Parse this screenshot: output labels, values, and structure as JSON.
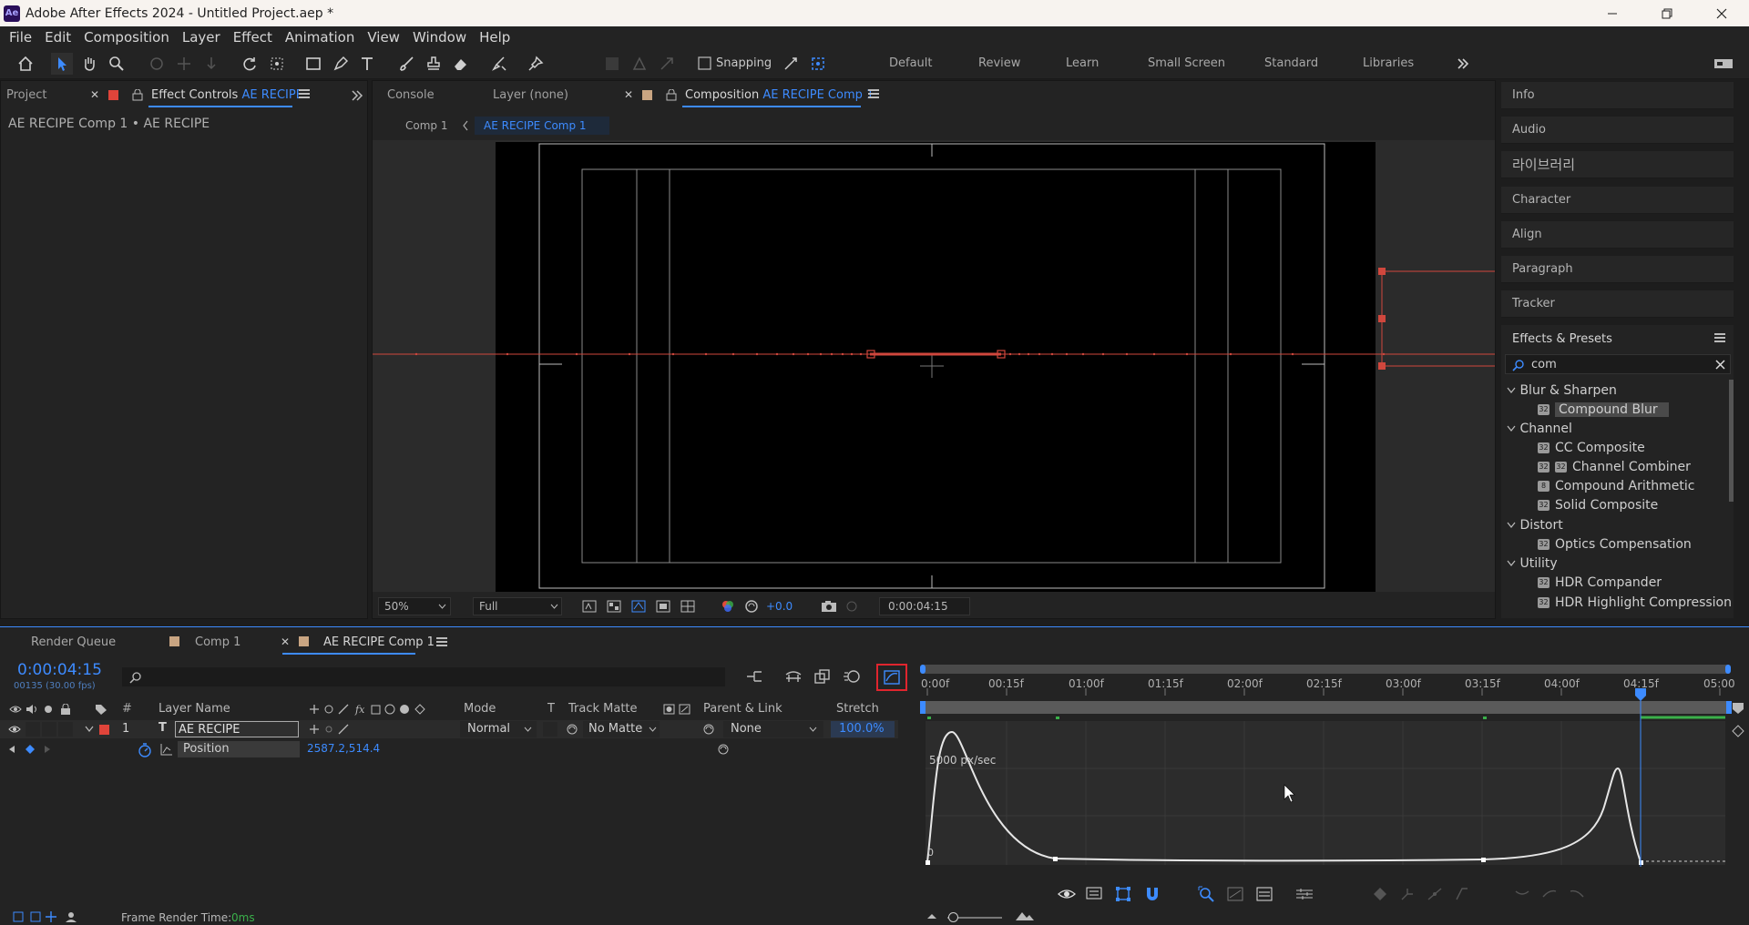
{
  "window": {
    "title": "Adobe After Effects 2024 - Untitled Project.aep *",
    "app_icon_text": "Ae"
  },
  "menu": [
    "File",
    "Edit",
    "Composition",
    "Layer",
    "Effect",
    "Animation",
    "View",
    "Window",
    "Help"
  ],
  "toolbar": {
    "snapping_label": "Snapping",
    "workspaces": [
      "Default",
      "Review",
      "Learn",
      "Small Screen",
      "Standard",
      "Libraries"
    ]
  },
  "left_panel": {
    "tab_project": "Project",
    "tab_effect_controls": "Effect Controls",
    "tab_effect_controls_layer": "AE RECIPE",
    "breadcrumb": "AE RECIPE Comp 1 • AE RECIPE"
  },
  "viewer": {
    "tab_console": "Console",
    "tab_layer": "Layer (none)",
    "tab_composition": "Composition",
    "tab_composition_name": "AE RECIPE Comp 1",
    "crumb_parent": "Comp 1",
    "crumb_current": "AE RECIPE Comp 1",
    "zoom": "50%",
    "resolution": "Full",
    "exposure": "+0.0",
    "timecode": "0:00:04:15"
  },
  "right_panels": [
    "Info",
    "Audio",
    "라이브러리",
    "Character",
    "Align",
    "Paragraph",
    "Tracker"
  ],
  "effects_presets": {
    "title": "Effects & Presets",
    "search_value": "com",
    "groups": [
      {
        "name": "Blur & Sharpen",
        "items": [
          "Compound Blur"
        ]
      },
      {
        "name": "Channel",
        "items": [
          "CC Composite",
          "Channel Combiner",
          "Compound Arithmetic",
          "Solid Composite"
        ]
      },
      {
        "name": "Distort",
        "items": [
          "Optics Compensation"
        ]
      },
      {
        "name": "Utility",
        "items": [
          "HDR Compander",
          "HDR Highlight Compression"
        ]
      }
    ]
  },
  "timeline": {
    "tab_render_queue": "Render Queue",
    "tab_comp1": "Comp 1",
    "tab_active": "AE RECIPE Comp 1",
    "current_time": "0:00:04:15",
    "frame_info": "00135 (30.00 fps)",
    "columns": {
      "hash": "#",
      "layer_name": "Layer Name",
      "mode": "Mode",
      "t": "T",
      "track_matte": "Track Matte",
      "parent_link": "Parent & Link",
      "stretch": "Stretch"
    },
    "layer": {
      "index": "1",
      "type_glyph": "T",
      "name": "AE RECIPE",
      "mode": "Normal",
      "track_matte": "No Matte",
      "parent": "None",
      "stretch": "100.0%"
    },
    "property": {
      "name": "Position",
      "value": "2587.2,514.4"
    },
    "ruler": [
      "0:00f",
      "00:15f",
      "01:00f",
      "01:15f",
      "02:00f",
      "02:15f",
      "03:00f",
      "03:15f",
      "04:00f",
      "04:15f",
      "05:00"
    ],
    "graph_label": "5000 px/sec",
    "graph_zero": "0",
    "frame_render_label": "Frame Render Time:",
    "frame_render_value": "0ms",
    "accent_color": "#3d8bff",
    "highlight_color": "#e0252e"
  }
}
